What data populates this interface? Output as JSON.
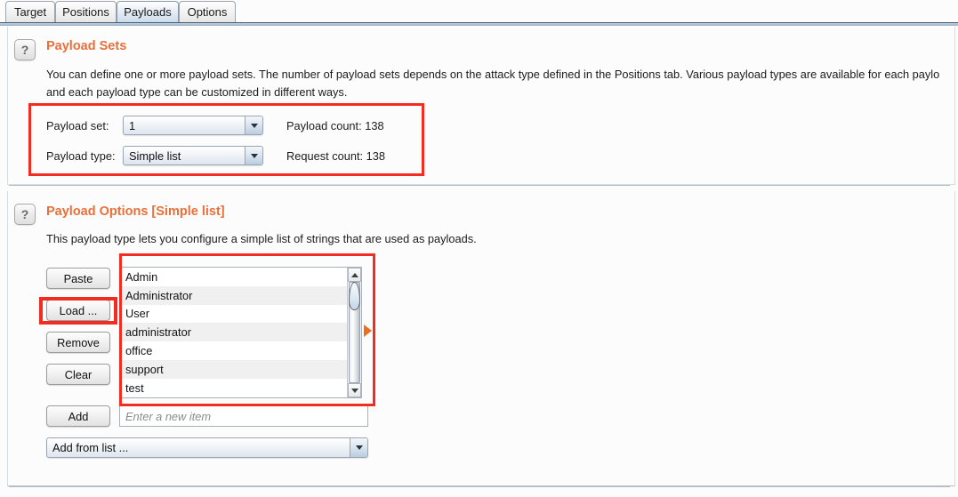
{
  "tabs": [
    {
      "label": "Target",
      "selected": false
    },
    {
      "label": "Positions",
      "selected": false
    },
    {
      "label": "Payloads",
      "selected": true
    },
    {
      "label": "Options",
      "selected": false
    }
  ],
  "payload_sets": {
    "help_icon": "question-mark-icon",
    "title": "Payload Sets",
    "description_line1": "You can define one or more payload sets. The number of payload sets depends on the attack type defined in the Positions tab. Various payload types are available for each paylo",
    "description_line2": "and each payload type can be customized in different ways.",
    "payload_set_label": "Payload set:",
    "payload_set_value": "1",
    "payload_type_label": "Payload type:",
    "payload_type_value": "Simple list",
    "payload_count_label": "Payload count:  138",
    "request_count_label": "Request count:  138"
  },
  "payload_options": {
    "help_icon": "question-mark-icon",
    "title": "Payload Options [Simple list]",
    "description": "This payload type lets you configure a simple list of strings that are used as payloads.",
    "buttons": {
      "paste": "Paste",
      "load": "Load ...",
      "remove": "Remove",
      "clear": "Clear",
      "add": "Add"
    },
    "list_items": [
      "Admin",
      "Administrator",
      "User",
      "administrator",
      "office",
      "support",
      "test"
    ],
    "new_item_placeholder": "Enter a new item",
    "new_item_value": "",
    "add_from_list_value": "Add from list ..."
  },
  "colors": {
    "accent_orange": "#e8703a",
    "annotation_red": "#f22c21",
    "marker_orange": "#ef6c1f",
    "tab_selected": "#ccdcec"
  }
}
